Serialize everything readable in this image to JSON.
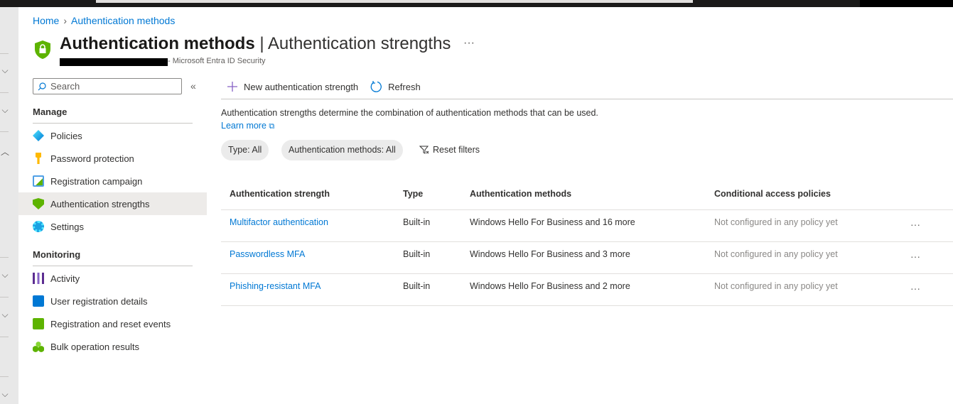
{
  "breadcrumb": {
    "home": "Home",
    "current": "Authentication methods"
  },
  "header": {
    "title_bold": "Authentication methods",
    "title_rest": " | Authentication strengths",
    "subtitle": "- Microsoft Entra ID Security",
    "more": "···"
  },
  "sidebar": {
    "search_placeholder": "Search",
    "collapse": "«",
    "sections": [
      {
        "label": "Manage"
      },
      {
        "label": "Monitoring"
      }
    ],
    "manage": [
      {
        "label": "Policies"
      },
      {
        "label": "Password protection"
      },
      {
        "label": "Registration campaign"
      },
      {
        "label": "Authentication strengths"
      },
      {
        "label": "Settings"
      }
    ],
    "monitoring": [
      {
        "label": "Activity"
      },
      {
        "label": "User registration details"
      },
      {
        "label": "Registration and reset events"
      },
      {
        "label": "Bulk operation results"
      }
    ]
  },
  "toolbar": {
    "new": "New authentication strength",
    "refresh": "Refresh"
  },
  "main": {
    "description": "Authentication strengths determine the combination of authentication methods that can be used.",
    "learn_more": "Learn more",
    "filters": {
      "type": "Type: All",
      "methods": "Authentication methods: All",
      "reset": "Reset filters"
    },
    "columns": [
      "Authentication strength",
      "Type",
      "Authentication methods",
      "Conditional access policies"
    ],
    "rows": [
      {
        "name": "Multifactor authentication",
        "type": "Built-in",
        "methods": "Windows Hello For Business and 16 more",
        "policies": "Not configured in any policy yet",
        "more": "···"
      },
      {
        "name": "Passwordless MFA",
        "type": "Built-in",
        "methods": "Windows Hello For Business and 3 more",
        "policies": "Not configured in any policy yet",
        "more": "···"
      },
      {
        "name": "Phishing-resistant MFA",
        "type": "Built-in",
        "methods": "Windows Hello For Business and 2 more",
        "policies": "Not configured in any policy yet",
        "more": "···"
      }
    ]
  },
  "colors": {
    "accent": "#0078d4",
    "selected": "#edebe9",
    "shield": "#5db300"
  }
}
